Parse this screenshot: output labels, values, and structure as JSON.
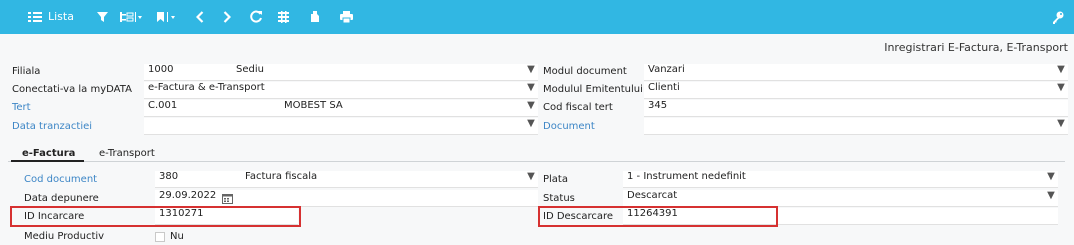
{
  "toolbar": {
    "lista_label": "Lista",
    "icons": [
      "list-icon",
      "filter-icon",
      "tree-icon",
      "bookmark-icon",
      "prev-icon",
      "next-icon",
      "refresh-icon",
      "grid-icon",
      "attach-icon",
      "print-icon",
      "key-icon"
    ]
  },
  "page_title": "Inregistrari E-Factura, E-Transport",
  "header_fields": {
    "filiala": {
      "label": "Filiala",
      "code": "1000",
      "name": "Sediu"
    },
    "conectati": {
      "label": "Conectati-va la myDATA",
      "value": "e-Factura & e-Transport"
    },
    "tert": {
      "label": "Tert",
      "code": "C.001",
      "name": "MOBEST SA"
    },
    "data_tranzactiei": {
      "label": "Data tranzactiei",
      "value": ""
    },
    "modul_document": {
      "label": "Modul document",
      "value": "Vanzari"
    },
    "modulul_emitentului": {
      "label": "Modulul Emitentului",
      "value": "Clienti"
    },
    "cod_fiscal_tert": {
      "label": "Cod fiscal tert",
      "value": "345"
    },
    "document": {
      "label": "Document",
      "value": ""
    }
  },
  "tabs": [
    {
      "label": "e-Factura",
      "active": true
    },
    {
      "label": "e-Transport",
      "active": false
    }
  ],
  "efactura": {
    "cod_document": {
      "label": "Cod document",
      "code": "380",
      "name": "Factura fiscala"
    },
    "data_depunere": {
      "label": "Data depunere",
      "value": "29.09.2022"
    },
    "id_incarcare": {
      "label": "ID Incarcare",
      "value": "1310271"
    },
    "mediu_productiv": {
      "label": "Mediu Productiv",
      "checkbox_label": "Nu",
      "checked": false
    },
    "plata": {
      "label": "Plata",
      "value": "1 - Instrument nedefinit"
    },
    "status": {
      "label": "Status",
      "value": "Descarcat"
    },
    "id_descarcare": {
      "label": "ID Descarcare",
      "value": "11264391"
    }
  },
  "colors": {
    "toolbar": "#31b7e3",
    "link_label": "#3d86c6",
    "highlight": "#d63131"
  }
}
